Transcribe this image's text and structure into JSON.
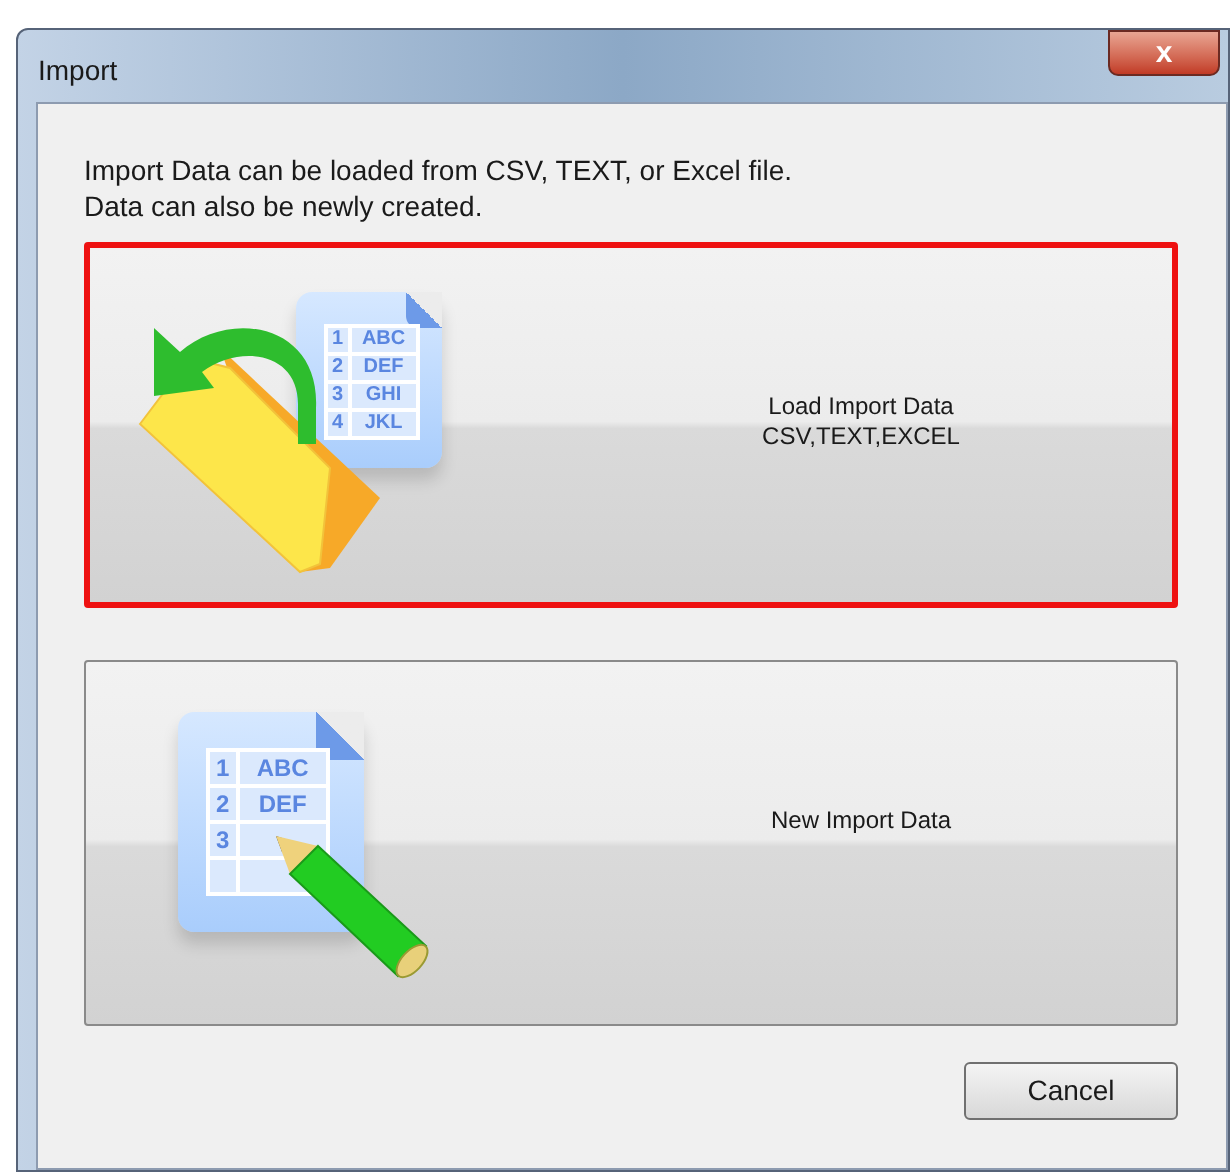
{
  "window": {
    "title": "Import",
    "close_label": "x"
  },
  "description": [
    "Import Data can be loaded from CSV, TEXT, or Excel file.",
    "Data can also be newly created."
  ],
  "options": [
    {
      "kind": "load",
      "selected": true,
      "lines": [
        "Load Import Data",
        "CSV,TEXT,EXCEL"
      ],
      "icon_rows": [
        {
          "num": "1",
          "text": "ABC"
        },
        {
          "num": "2",
          "text": "DEF"
        },
        {
          "num": "3",
          "text": "GHI"
        },
        {
          "num": "4",
          "text": "JKL"
        }
      ]
    },
    {
      "kind": "new",
      "selected": false,
      "lines": [
        "New Import Data"
      ],
      "icon_rows": [
        {
          "num": "1",
          "text": "ABC"
        },
        {
          "num": "2",
          "text": "DEF"
        },
        {
          "num": "3"
        }
      ]
    }
  ],
  "buttons": [
    "Cancel"
  ]
}
